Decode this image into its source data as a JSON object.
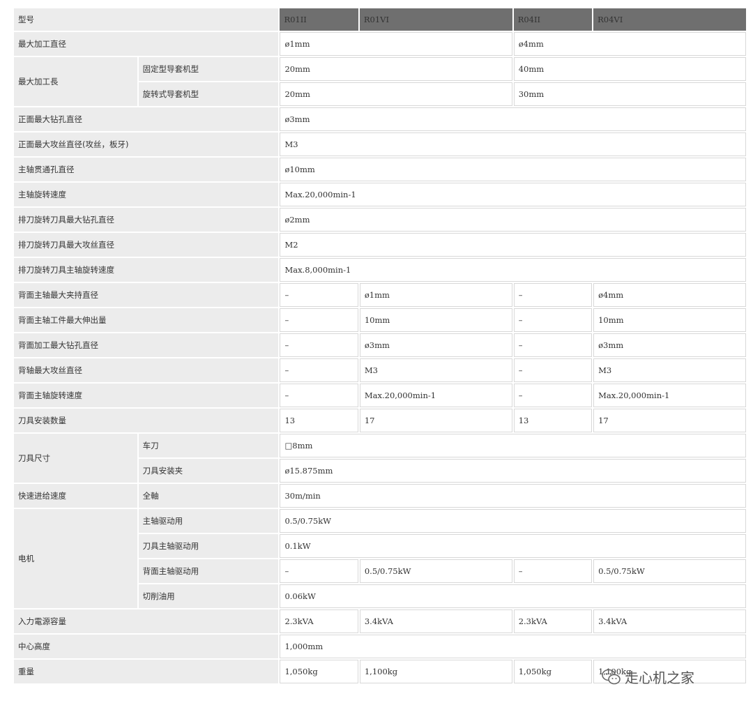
{
  "header": {
    "label": "型号",
    "models": [
      "R01II",
      "R01VI",
      "R04II",
      "R04VI"
    ]
  },
  "rows": {
    "max_dia": {
      "label": "最大加工直径",
      "r01": "ø1mm",
      "r04": "ø4mm"
    },
    "max_len": {
      "label": "最大加工長",
      "fixed": {
        "label": "固定型导套机型",
        "r01": "20mm",
        "r04": "40mm"
      },
      "rotary": {
        "label": "旋转式导套机型",
        "r01": "20mm",
        "r04": "30mm"
      }
    },
    "front_drill": {
      "label": "正面最大钻孔直径",
      "value": "ø3mm"
    },
    "front_tap": {
      "label": "正面最大攻丝直径(攻丝，板牙)",
      "value": "M3"
    },
    "spindle_bore": {
      "label": "主轴贯通孔直径",
      "value": "ø10mm"
    },
    "spindle_speed": {
      "label": "主轴旋转速度",
      "value": "Max.20,000min-1"
    },
    "gang_drill": {
      "label": "排刀旋转刀具最大钻孔直径",
      "value": "ø2mm"
    },
    "gang_tap": {
      "label": "排刀旋转刀具最大攻丝直径",
      "value": "M2"
    },
    "gang_speed": {
      "label": "排刀旋转刀具主轴旋转速度",
      "value": "Max.8,000min-1"
    },
    "back_chuck": {
      "label": "背面主轴最大夹持直径",
      "values": [
        "–",
        "ø1mm",
        "–",
        "ø4mm"
      ]
    },
    "back_extend": {
      "label": "背面主轴工件最大伸出量",
      "values": [
        "–",
        "10mm",
        "–",
        "10mm"
      ]
    },
    "back_drill": {
      "label": "背面加工最大钻孔直径",
      "values": [
        "–",
        "ø3mm",
        "–",
        "ø3mm"
      ]
    },
    "back_tap": {
      "label": "背轴最大攻丝直径",
      "values": [
        "–",
        "M3",
        "–",
        "M3"
      ]
    },
    "back_speed": {
      "label": "背面主轴旋转速度",
      "values": [
        "–",
        "Max.20,000min-1",
        "–",
        "Max.20,000min-1"
      ]
    },
    "tool_count": {
      "label": "刀具安装数量",
      "values": [
        "13",
        "17",
        "13",
        "17"
      ]
    },
    "tool_size": {
      "label": "刀具尺寸",
      "turning": {
        "label": "车刀",
        "value": "□8mm"
      },
      "holder": {
        "label": "刀具安装夹",
        "value": "ø15.875mm"
      }
    },
    "rapid": {
      "label": "快速进给速度",
      "sub": "全軸",
      "value": "30m/min"
    },
    "motor": {
      "label": "电机",
      "main": {
        "label": "主轴驱动用",
        "value": "0.5/0.75kW"
      },
      "tool": {
        "label": "刀具主轴驱动用",
        "value": "0.1kW"
      },
      "back": {
        "label": "背面主轴驱动用",
        "values": [
          "–",
          "0.5/0.75kW",
          "–",
          "0.5/0.75kW"
        ]
      },
      "coolant": {
        "label": "切削油用",
        "value": "0.06kW"
      }
    },
    "power": {
      "label": "入力電源容量",
      "values": [
        "2.3kVA",
        "3.4kVA",
        "2.3kVA",
        "3.4kVA"
      ]
    },
    "center_height": {
      "label": "中心高度",
      "value": "1,000mm"
    },
    "weight": {
      "label": "重量",
      "values": [
        "1,050kg",
        "1,100kg",
        "1,050kg",
        "1,100kg"
      ]
    }
  },
  "watermark": {
    "text": "走心机之家",
    "icon": "wechat-icon"
  }
}
